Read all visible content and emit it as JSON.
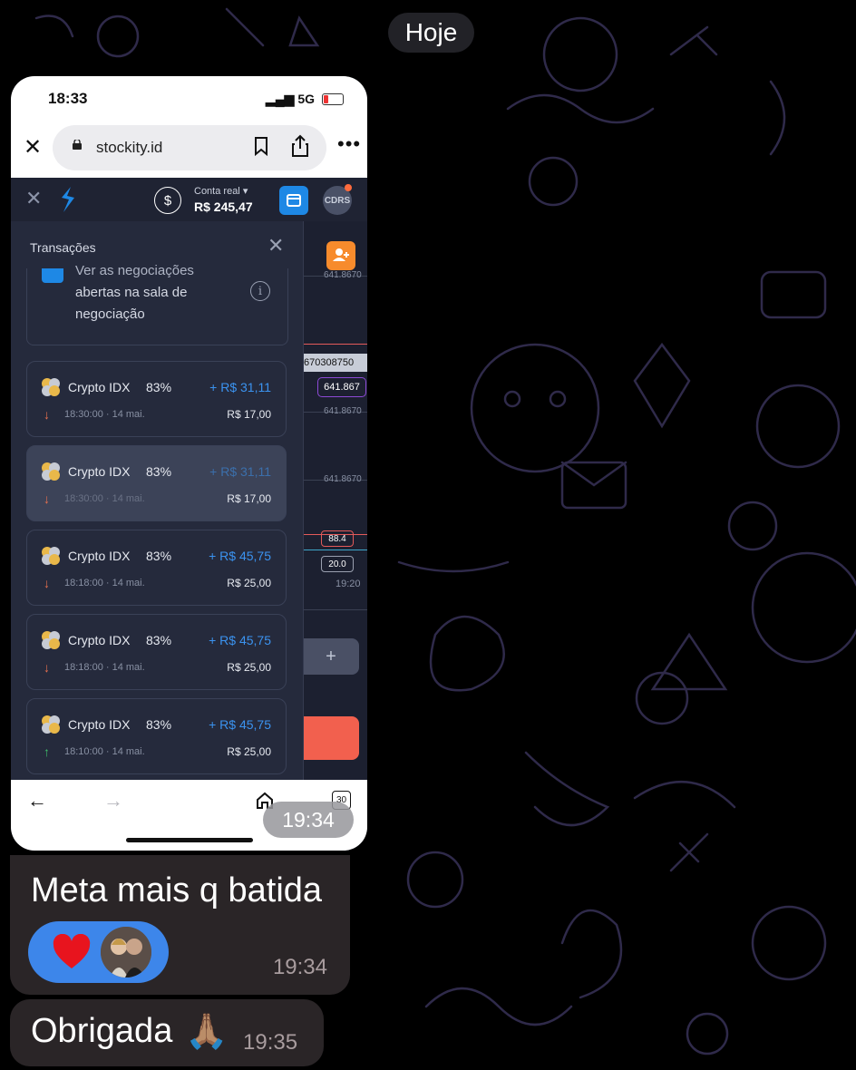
{
  "chat": {
    "date_label": "Hoje",
    "image_time": "19:34",
    "messages": [
      {
        "text": "Meta mais q batida",
        "time": "19:34",
        "reaction_emoji": "❤️"
      },
      {
        "text": "Obrigada",
        "emoji": "🙏🏽",
        "time": "19:35"
      }
    ]
  },
  "phone": {
    "status": {
      "time": "18:33",
      "network": "5G"
    },
    "browser": {
      "url": "stockity.id",
      "more": "•••",
      "tab_count": "30"
    },
    "app": {
      "account_label": "Conta real",
      "account_value": "R$ 245,47",
      "avatar_text": "CDRS"
    },
    "chart": {
      "price_labels": [
        "641.8670",
        "641.8670",
        "641.8670"
      ],
      "current_price_tag": "670308750",
      "price_tag": "641.867",
      "indicator_high": "88.4",
      "indicator_low": "20.0",
      "time_label": "19:20",
      "plus": "+"
    },
    "panel": {
      "title": "Transações",
      "checkbox_lines": [
        "Ver as negociações",
        "abertas na sala de",
        "negociação"
      ],
      "transactions": [
        {
          "asset": "Crypto IDX",
          "percent": "83%",
          "profit": "+ R$ 31,11",
          "direction": "down",
          "datetime": "18:30:00 · 14 mai.",
          "amount": "R$ 17,00"
        },
        {
          "asset": "Crypto IDX",
          "percent": "83%",
          "profit": "+ R$ 31,11",
          "direction": "down",
          "datetime": "18:30:00 · 14 mai.",
          "amount": "R$ 17,00",
          "selected": true
        },
        {
          "asset": "Crypto IDX",
          "percent": "83%",
          "profit": "+ R$ 45,75",
          "direction": "down",
          "datetime": "18:18:00 · 14 mai.",
          "amount": "R$ 25,00"
        },
        {
          "asset": "Crypto IDX",
          "percent": "83%",
          "profit": "+ R$ 45,75",
          "direction": "down",
          "datetime": "18:18:00 · 14 mai.",
          "amount": "R$ 25,00"
        },
        {
          "asset": "Crypto IDX",
          "percent": "83%",
          "profit": "+ R$ 45,75",
          "direction": "up",
          "datetime": "18:10:00 · 14 mai.",
          "amount": "R$ 25,00"
        }
      ]
    }
  },
  "colors": {
    "accent_blue": "#3d86ea",
    "profit_blue": "#3b93f0",
    "down": "#e8704f",
    "up": "#3fbe6a",
    "bubble": "#2a2527"
  }
}
